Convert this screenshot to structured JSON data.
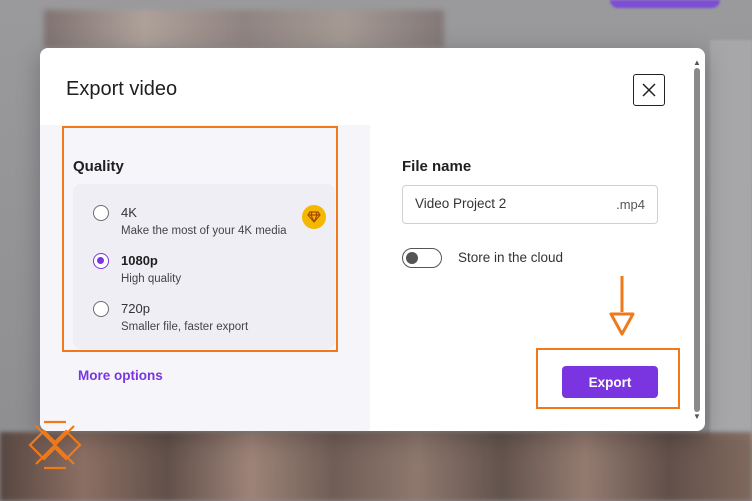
{
  "dialog": {
    "title": "Export video",
    "close_icon": "close-icon"
  },
  "quality": {
    "heading": "Quality",
    "options": [
      {
        "label": "4K",
        "description": "Make the most of your 4K media",
        "selected": false,
        "premium": true,
        "icon": "diamond-icon"
      },
      {
        "label": "1080p",
        "description": "High quality",
        "selected": true,
        "premium": false
      },
      {
        "label": "720p",
        "description": "Smaller file, faster export",
        "selected": false,
        "premium": false
      }
    ],
    "more_options": "More options"
  },
  "file": {
    "heading": "File name",
    "value": "Video Project 2",
    "extension": ".mp4"
  },
  "cloud": {
    "label": "Store in the cloud",
    "enabled": false
  },
  "export": {
    "label": "Export"
  },
  "colors": {
    "accent": "#7a35e0",
    "annotation": "#f07a1a",
    "premium": "#f5b800"
  }
}
